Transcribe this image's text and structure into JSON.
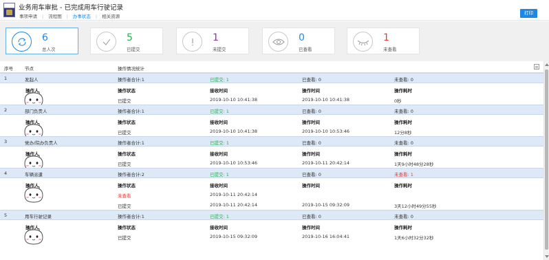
{
  "header": {
    "title": "业务用车审批 - 已完成用车行驶记录",
    "tabs": [
      "事项申请",
      "流程图",
      "办事状态",
      "相关资源"
    ],
    "print_label": "打印"
  },
  "stats": [
    {
      "value": "6",
      "label": "总人次",
      "color": "#1e88e5",
      "icon": "refresh-icon"
    },
    {
      "value": "5",
      "label": "已提交",
      "color": "#27ae4f",
      "icon": "check-icon"
    },
    {
      "value": "1",
      "label": "未提交",
      "color": "#9c27b0",
      "icon": "exclamation-icon"
    },
    {
      "value": "0",
      "label": "已查看",
      "color": "#1e88e5",
      "icon": "eye-icon"
    },
    {
      "value": "1",
      "label": "未查看",
      "color": "#e53935",
      "icon": "eye-closed-icon"
    }
  ],
  "table": {
    "headers": {
      "seq": "序号",
      "node": "节点",
      "stats": "操作情况统计"
    },
    "sub_headers": {
      "operator": "操作人",
      "status": "操作状态",
      "received": "接收时间",
      "operated": "操作时间",
      "duration": "操作耗时"
    },
    "nodes": [
      {
        "seq": "1",
        "name": "发起人",
        "total": "操作者合计:1",
        "submitted": "已提交: 1",
        "viewed": "已查看: 0",
        "not_viewed": "未查看: 0",
        "records": [
          {
            "status": "已提交",
            "received": "2019-10-10 10:41:38",
            "operated": "2019-10-10 10:41:38",
            "duration": "0秒"
          }
        ]
      },
      {
        "seq": "2",
        "name": "部门负责人",
        "total": "操作者合计:1",
        "submitted": "已提交: 1",
        "viewed": "已查看: 0",
        "not_viewed": "未查看: 0",
        "records": [
          {
            "status": "已提交",
            "received": "2019-10-10 10:41:38",
            "operated": "2019-10-10 10:53:46",
            "duration": "12分8秒"
          }
        ]
      },
      {
        "seq": "3",
        "name": "党办/院办负责人",
        "total": "操作者合计:1",
        "submitted": "已提交: 1",
        "viewed": "已查看: 0",
        "not_viewed": "未查看: 0",
        "records": [
          {
            "status": "已提交",
            "received": "2019-10-10 10:53:46",
            "operated": "2019-10-11 20:42:14",
            "duration": "1天9小时48分28秒"
          }
        ]
      },
      {
        "seq": "4",
        "name": "车辆派遣",
        "total": "操作者合计:2",
        "submitted": "已提交: 1",
        "viewed": "已查看: 0",
        "not_viewed": "未查看: 1",
        "records": [
          {
            "status": "未查看",
            "received": "2019-10-11 20:42:14",
            "operated": "",
            "duration": ""
          },
          {
            "status": "已提交",
            "received": "2019-10-11 20:42:14",
            "operated": "2019-10-15 09:32:09",
            "duration": "3天12小时49分55秒"
          }
        ]
      },
      {
        "seq": "5",
        "name": "用车行驶记录",
        "total": "操作者合计:1",
        "submitted": "已提交: 1",
        "viewed": "已查看: 0",
        "not_viewed": "未查看: 0",
        "records": [
          {
            "status": "已提交",
            "received": "2019-10-15 09:32:09",
            "operated": "2019-10-16 16:04:41",
            "duration": "1天6小时32分32秒"
          }
        ]
      }
    ]
  }
}
